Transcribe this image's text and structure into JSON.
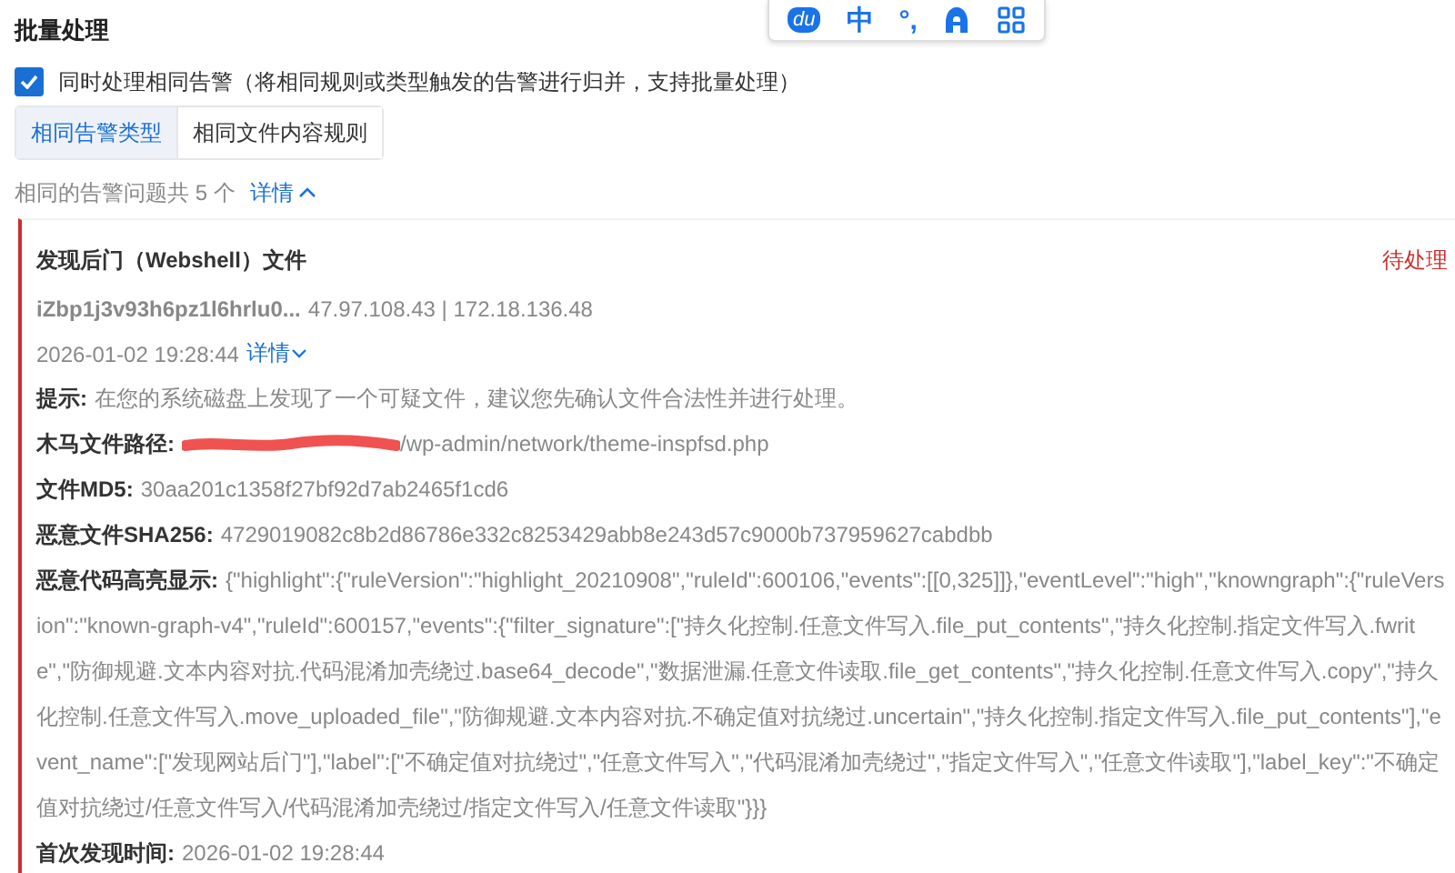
{
  "ime_toolbar": {
    "logo": "du",
    "mode": "中",
    "punctuation": "°,"
  },
  "section_title": "批量处理",
  "merge_option": {
    "label": "同时处理相同告警（将相同规则或类型触发的告警进行归并，支持批量处理）",
    "checked": true
  },
  "tabs": [
    {
      "label": "相同告警类型",
      "selected": true
    },
    {
      "label": "相同文件内容规则",
      "selected": false
    }
  ],
  "summary": {
    "text": "相同的告警问题共 5 个",
    "link": "详情",
    "expanded": true
  },
  "alert": {
    "title": "发现后门（Webshell）文件",
    "status": "待处理",
    "host": "iZbp1j3v93h6pz1l6hrlu0...",
    "ips": "47.97.108.43 | 172.18.136.48",
    "time": "2026-01-02 19:28:44",
    "details_link": "详情",
    "details_expanded": false,
    "fields": [
      {
        "label": "提示:",
        "value": "在您的系统磁盘上发现了一个可疑文件，建议您先确认文件合法性并进行处理。",
        "redacted": false
      },
      {
        "label": "木马文件路径:",
        "value": "/wp-admin/network/theme-inspfsd.php",
        "redacted": true
      },
      {
        "label": "文件MD5:",
        "value": "30aa201c1358f27bf92d7ab2465f1cd6",
        "redacted": false
      },
      {
        "label": "恶意文件SHA256:",
        "value": "4729019082c8b2d86786e332c8253429abb8e243d57c9000b737959627cabdbb",
        "redacted": false
      },
      {
        "label": "恶意代码高亮显示:",
        "value": "{\"highlight\":{\"ruleVersion\":\"highlight_20210908\",\"ruleId\":600106,\"events\":[[0,325]]},\"eventLevel\":\"high\",\"knowngraph\":{\"ruleVersion\":\"known-graph-v4\",\"ruleId\":600157,\"events\":{\"filter_signature\":[\"持久化控制.任意文件写入.file_put_contents\",\"持久化控制.指定文件写入.fwrite\",\"防御规避.文本内容对抗.代码混淆加壳绕过.base64_decode\",\"数据泄漏.任意文件读取.file_get_contents\",\"持久化控制.任意文件写入.copy\",\"持久化控制.任意文件写入.move_uploaded_file\",\"防御规避.文本内容对抗.不确定值对抗绕过.uncertain\",\"持久化控制.指定文件写入.file_put_contents\"],\"event_name\":[\"发现网站后门\"],\"label\":[\"不确定值对抗绕过\",\"任意文件写入\",\"代码混淆加壳绕过\",\"指定文件写入\",\"任意文件读取\"],\"label_key\":\"不确定值对抗绕过/任意文件写入/代码混淆加壳绕过/指定文件写入/任意文件读取\"}}}",
        "redacted": false
      },
      {
        "label": "首次发现时间:",
        "value": "2026-01-02 19:28:44",
        "redacted": false
      }
    ]
  }
}
